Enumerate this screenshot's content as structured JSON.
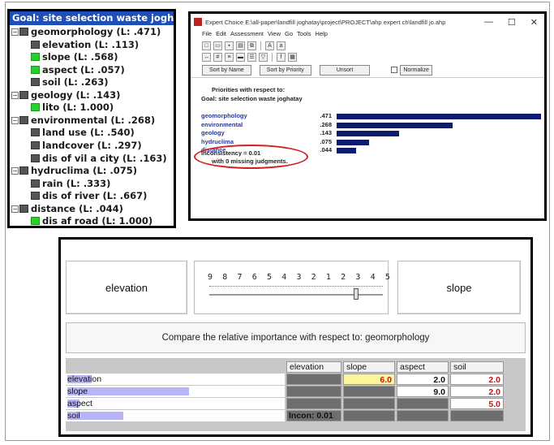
{
  "tree": {
    "goal": "Goal: site selection waste joghatay",
    "rows": [
      {
        "label": "geomorphology (L: .471)",
        "level": 0,
        "expander": "−",
        "color": "dark"
      },
      {
        "label": "elevation (L: .113)",
        "level": 1,
        "color": "dark"
      },
      {
        "label": "slope (L: .568)",
        "level": 1,
        "color": "green"
      },
      {
        "label": "aspect (L: .057)",
        "level": 1,
        "color": "green"
      },
      {
        "label": "soil (L: .263)",
        "level": 1,
        "color": "dark"
      },
      {
        "label": "geology (L: .143)",
        "level": 0,
        "expander": "−",
        "color": "dark"
      },
      {
        "label": "lito (L: 1.000)",
        "level": 1,
        "color": "green"
      },
      {
        "label": "environmental (L: .268)",
        "level": 0,
        "expander": "−",
        "color": "dark"
      },
      {
        "label": "land use (L: .540)",
        "level": 1,
        "color": "dark"
      },
      {
        "label": "landcover (L: .297)",
        "level": 1,
        "color": "dark"
      },
      {
        "label": "dis of vil a city (L: .163)",
        "level": 1,
        "color": "dark"
      },
      {
        "label": "hydruclima (L: .075)",
        "level": 0,
        "expander": "−",
        "color": "dark"
      },
      {
        "label": "rain (L: .333)",
        "level": 1,
        "color": "dark"
      },
      {
        "label": "dis of river (L: .667)",
        "level": 1,
        "color": "dark"
      },
      {
        "label": "distance (L: .044)",
        "level": 0,
        "expander": "−",
        "color": "dark"
      },
      {
        "label": "dis af road (L: 1.000)",
        "level": 1,
        "color": "green"
      }
    ]
  },
  "expert_choice": {
    "title": "Expert Choice   E:\\all-paper\\landfill joghatay\\project\\PROJECT\\ahp expert ch\\landfill jo.ahp",
    "window_controls": [
      "—",
      "☐",
      "✕"
    ],
    "menu": [
      "File",
      "Edit",
      "Assessment",
      "View",
      "Go",
      "Tools",
      "Help"
    ],
    "buttons": {
      "sort_name": "Sort by Name",
      "sort_priority": "Sort by Priority",
      "unsort": "Unsort",
      "normalize": "Normalize"
    },
    "heading1": "Priorities with respect to:",
    "heading2": "Goal: site selection waste joghatay",
    "priorities": [
      {
        "name": "geomorphology",
        "value": ".471",
        "weight": 0.471
      },
      {
        "name": "environmental",
        "value": ".268",
        "weight": 0.268
      },
      {
        "name": "geology",
        "value": ".143",
        "weight": 0.143
      },
      {
        "name": "hydruclima",
        "value": ".075",
        "weight": 0.075
      },
      {
        "name": "distance",
        "value": ".044",
        "weight": 0.044
      }
    ],
    "inconsistency": "Inconsistency = 0.01",
    "missing": "with 0  missing judgments."
  },
  "comparison": {
    "left": "elevation",
    "right": "slope",
    "scale": "9 8 7 6 5 4 3 2 1 2 3 4 5 6 7 8 9",
    "caption": "Compare the relative importance with respect to: geomorphology",
    "columns": [
      "elevation",
      "slope",
      "aspect",
      "soil"
    ],
    "rows": [
      "elevation",
      "slope",
      "aspect",
      "soil"
    ],
    "row_weights": [
      0.113,
      0.568,
      0.057,
      0.263
    ],
    "cells": {
      "r0c1": "6.0",
      "r0c2": "2.0",
      "r0c3": "2.0",
      "r1c2": "9.0",
      "r1c3": "2.0",
      "r2c3": "5.0"
    },
    "incon": "Incon: 0.01"
  }
}
